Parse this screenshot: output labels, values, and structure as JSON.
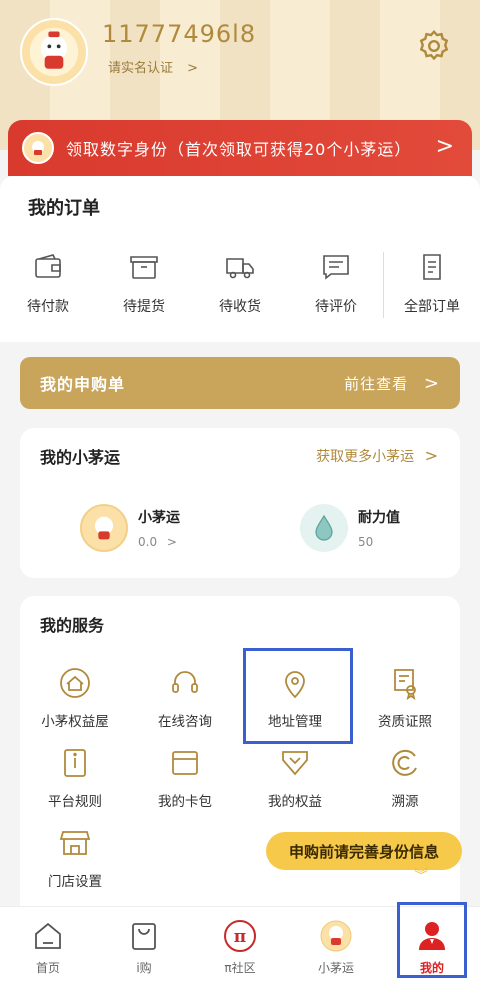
{
  "header": {
    "user_id": "11777496l8",
    "verify_label": "请实名认证",
    "verify_chevron": ">"
  },
  "banner": {
    "text": "领取数字身份（首次领取可获得20个小茅运）",
    "chevron": ">"
  },
  "orders": {
    "title": "我的订单",
    "items": [
      {
        "label": "待付款",
        "icon": "wallet-icon"
      },
      {
        "label": "待提货",
        "icon": "box-icon"
      },
      {
        "label": "待收货",
        "icon": "truck-icon"
      },
      {
        "label": "待评价",
        "icon": "comment-icon"
      },
      {
        "label": "全部订单",
        "icon": "document-icon"
      }
    ]
  },
  "apply": {
    "title": "我的申购单",
    "go_label": "前往查看",
    "chevron": ">"
  },
  "maoyun": {
    "title": "我的小茅运",
    "more_label": "获取更多小茅运",
    "stats": [
      {
        "name": "小茅运",
        "value": "0.0",
        "extra": ">"
      },
      {
        "name": "耐力值",
        "value": "50"
      }
    ]
  },
  "services": {
    "title": "我的服务",
    "items": [
      {
        "label": "小茅权益屋",
        "icon": "house-icon"
      },
      {
        "label": "在线咨询",
        "icon": "headset-icon"
      },
      {
        "label": "地址管理",
        "icon": "location-pin-icon"
      },
      {
        "label": "资质证照",
        "icon": "certificate-icon"
      },
      {
        "label": "平台规则",
        "icon": "info-book-icon"
      },
      {
        "label": "我的卡包",
        "icon": "card-icon"
      },
      {
        "label": "我的权益",
        "icon": "heart-badge-icon"
      },
      {
        "label": "溯源",
        "icon": "trace-icon"
      },
      {
        "label": "门店设置",
        "icon": "store-icon"
      }
    ]
  },
  "tip": {
    "text": "申购前请完善身份信息",
    "arrow": "︾"
  },
  "tabbar": {
    "items": [
      {
        "label": "首页",
        "icon": "home-icon"
      },
      {
        "label": "i购",
        "icon": "bag-icon"
      },
      {
        "label": "π社区",
        "icon": "pi-icon"
      },
      {
        "label": "小茅运",
        "icon": "mascot-icon"
      },
      {
        "label": "我的",
        "icon": "user-icon"
      }
    ],
    "active_index": 4
  },
  "colors": {
    "accent": "#c9a45b",
    "banner_red": "#d93a2e",
    "tip_yellow": "#f7c94a",
    "active_red": "#dd2222",
    "highlight": "#3a5fd0"
  }
}
